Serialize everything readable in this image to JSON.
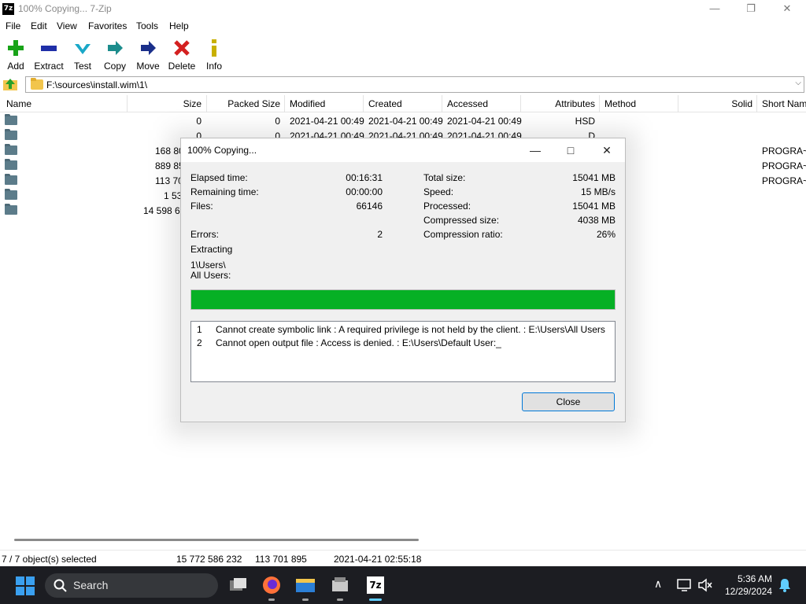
{
  "window": {
    "icon_text": "7z",
    "title": "100% Copying... 7-Zip"
  },
  "menu": [
    "File",
    "Edit",
    "View",
    "Favorites",
    "Tools",
    "Help"
  ],
  "toolbar": [
    {
      "label": "Add",
      "icon": "plus-icon",
      "color": "#18a318"
    },
    {
      "label": "Extract",
      "icon": "minus-icon",
      "color": "#1f2fa8"
    },
    {
      "label": "Test",
      "icon": "check-arrow-icon",
      "color": "#1aa8c8"
    },
    {
      "label": "Copy",
      "icon": "copy-arrow-icon",
      "color": "#1c8c8c"
    },
    {
      "label": "Move",
      "icon": "move-arrow-icon",
      "color": "#1a2f8a"
    },
    {
      "label": "Delete",
      "icon": "x-icon",
      "color": "#d42020"
    },
    {
      "label": "Info",
      "icon": "info-icon",
      "color": "#c8b000"
    }
  ],
  "address": {
    "path": "F:\\sources\\install.wim\\1\\"
  },
  "columns": {
    "name": "Name",
    "size": "Size",
    "packed": "Packed Size",
    "modified": "Modified",
    "created": "Created",
    "accessed": "Accessed",
    "attributes": "Attributes",
    "method": "Method",
    "solid": "Solid",
    "short_name": "Short Nam"
  },
  "files": [
    {
      "size": "0",
      "packed": "0",
      "modified": "2021-04-21 00:49",
      "created": "2021-04-21 00:49",
      "accessed": "2021-04-21 00:49",
      "attributes": "HSD",
      "short_name": ""
    },
    {
      "size": "0",
      "packed": "0",
      "modified": "2021-04-21 00:49",
      "created": "2021-04-21 00:49",
      "accessed": "2021-04-21 00:49",
      "attributes": "D",
      "short_name": ""
    },
    {
      "size": "168 80",
      "packed": "",
      "modified": "",
      "created": "",
      "accessed": "",
      "attributes": "",
      "short_name": "PROGRA~"
    },
    {
      "size": "889 85",
      "packed": "",
      "modified": "",
      "created": "",
      "accessed": "",
      "attributes": "",
      "short_name": "PROGRA~"
    },
    {
      "size": "113 70",
      "packed": "",
      "modified": "",
      "created": "",
      "accessed": "",
      "attributes": "",
      "short_name": "PROGRA~"
    },
    {
      "size": "1 53",
      "packed": "",
      "modified": "",
      "created": "",
      "accessed": "",
      "attributes": "",
      "short_name": ""
    },
    {
      "size": "14 598 68",
      "packed": "",
      "modified": "",
      "created": "",
      "accessed": "",
      "attributes": "",
      "short_name": ""
    }
  ],
  "status": {
    "selection": "7 / 7 object(s) selected",
    "size": "15 772 586 232",
    "packed": "113 701 895",
    "date": "2021-04-21 02:55:18"
  },
  "dialog": {
    "title": "100% Copying...",
    "elapsed_label": "Elapsed time:",
    "elapsed": "00:16:31",
    "remaining_label": "Remaining time:",
    "remaining": "00:00:00",
    "files_label": "Files:",
    "files": "66146",
    "errors_label": "Errors:",
    "errors": "2",
    "total_label": "Total size:",
    "total": "15041 MB",
    "speed_label": "Speed:",
    "speed": "15 MB/s",
    "processed_label": "Processed:",
    "processed": "15041 MB",
    "compressed_label": "Compressed size:",
    "compressed": "4038 MB",
    "ratio_label": "Compression ratio:",
    "ratio": "26%",
    "operation": "Extracting",
    "current_path": "1\\Users\\",
    "current_file": "All Users:",
    "progress_percent": 100,
    "errors_list": [
      {
        "num": "1",
        "text": "Cannot create symbolic link : A required privilege is not held by the client. : E:\\Users\\All Users"
      },
      {
        "num": "2",
        "text": "Cannot open output file : Access is denied. : E:\\Users\\Default User:_"
      }
    ],
    "close_label": "Close"
  },
  "taskbar": {
    "search": "Search",
    "time": "5:36 AM",
    "date": "12/29/2024"
  }
}
